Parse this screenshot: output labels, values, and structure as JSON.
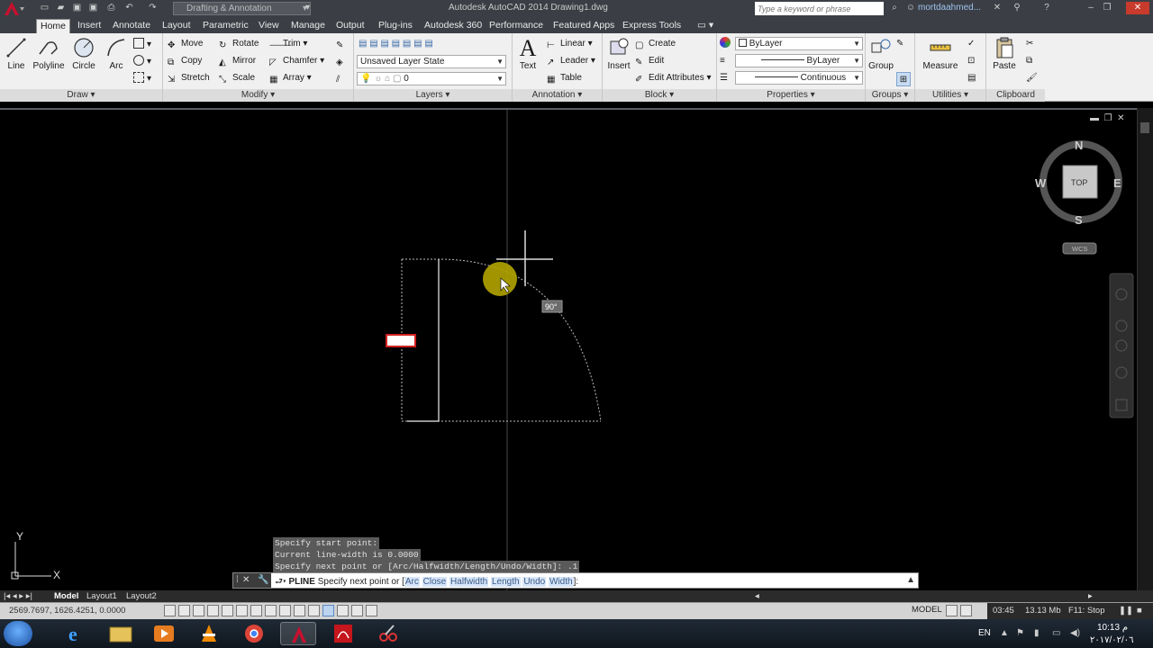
{
  "title_bar": {
    "workspace": "Drafting & Annotation",
    "window_title": "Autodesk AutoCAD 2014    Drawing1.dwg",
    "search_placeholder": "Type a keyword or phrase",
    "user": "mortdaahmed..."
  },
  "tabs": [
    "Home",
    "Insert",
    "Annotate",
    "Layout",
    "Parametric",
    "View",
    "Manage",
    "Output",
    "Plug-ins",
    "Autodesk 360",
    "Performance",
    "Featured Apps",
    "Express Tools"
  ],
  "active_tab": "Home",
  "ribbon": {
    "draw": {
      "title": "Draw",
      "line": "Line",
      "polyline": "Polyline",
      "circle": "Circle",
      "arc": "Arc"
    },
    "modify": {
      "title": "Modify",
      "move": "Move",
      "rotate": "Rotate",
      "trim": "Trim",
      "copy": "Copy",
      "mirror": "Mirror",
      "chamfer": "Chamfer",
      "stretch": "Stretch",
      "scale": "Scale",
      "array": "Array"
    },
    "layers": {
      "title": "Layers",
      "layer_state": "Unsaved Layer State",
      "current_layer": "0"
    },
    "annotation": {
      "title": "Annotation",
      "text": "Text",
      "linear": "Linear",
      "leader": "Leader",
      "table": "Table"
    },
    "block": {
      "title": "Block",
      "insert": "Insert",
      "create": "Create",
      "edit": "Edit",
      "edit_attributes": "Edit Attributes"
    },
    "properties": {
      "title": "Properties",
      "color": "ByLayer",
      "lineweight": "ByLayer",
      "linetype": "Continuous"
    },
    "groups": {
      "title": "Groups",
      "group": "Group"
    },
    "utilities": {
      "title": "Utilities",
      "measure": "Measure"
    },
    "clipboard": {
      "title": "Clipboard",
      "paste": "Paste"
    }
  },
  "viewcube": {
    "north": "N",
    "south": "S",
    "east": "E",
    "west": "W",
    "face": "TOP",
    "wcs": "WCS"
  },
  "drawing": {
    "angle_tooltip": "90°"
  },
  "ucs": {
    "x": "X",
    "y": "Y"
  },
  "command": {
    "history": [
      "Specify start point:",
      "Current line-width is 0.0000",
      "Specify next point or [Arc/Halfwidth/Length/Undo/Width]: .1"
    ],
    "prompt_cmd": "PLINE",
    "prompt_text": "Specify next point or [",
    "options": [
      "Arc",
      "Close",
      "Halfwidth",
      "Length",
      "Undo",
      "Width"
    ],
    "prompt_end": "]:"
  },
  "layout_tabs": [
    "Model",
    "Layout1",
    "Layout2"
  ],
  "status": {
    "coords": "2569.7697, 1626.4251, 0.0000",
    "model": "MODEL",
    "time_elapsed": "03:45",
    "memory": "13.13 Mb",
    "stop": "F11: Stop"
  },
  "taskbar": {
    "lang": "EN",
    "time": "10:13 م",
    "date": "٢٠١٧/٠٢/٠٦"
  }
}
